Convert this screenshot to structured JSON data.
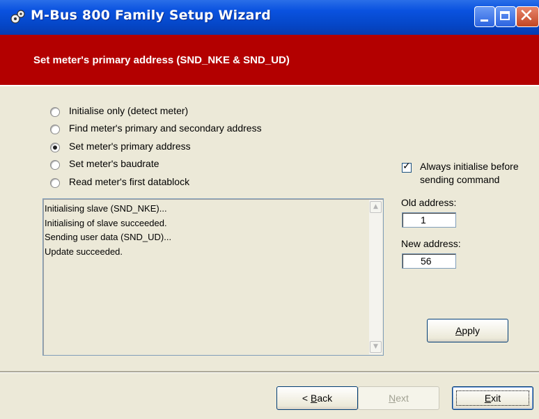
{
  "window": {
    "title": "M-Bus 800 Family Setup Wizard",
    "icon": "wizard-app-icon",
    "controls": [
      "minimize",
      "maximize",
      "close"
    ]
  },
  "header": {
    "title": "Set meter's primary address (SND_NKE & SND_UD)",
    "background_color": "#b30000"
  },
  "options": [
    {
      "label": "Initialise only (detect meter)",
      "checked": false
    },
    {
      "label": "Find meter's primary and secondary address",
      "checked": false
    },
    {
      "label": "Set meter's primary address",
      "checked": true
    },
    {
      "label": "Set meter's baudrate",
      "checked": false
    },
    {
      "label": "Read meter's first datablock",
      "checked": false
    }
  ],
  "log": {
    "lines": [
      "Initialising slave (SND_NKE)...",
      "Initialising of slave succeeded.",
      "Sending user data (SND_UD)...",
      "Update succeeded."
    ]
  },
  "always_initialise": {
    "checked": true,
    "line1": "Always initialise before",
    "line2": "sending command"
  },
  "old_address": {
    "label": "Old address:",
    "value": "1"
  },
  "new_address": {
    "label": "New address:",
    "value": "56"
  },
  "buttons": {
    "apply_pre": "",
    "apply_mnemonic": "A",
    "apply_post": "pply",
    "back_pre": "< ",
    "back_mnemonic": "B",
    "back_post": "ack",
    "next_pre": "",
    "next_mnemonic": "N",
    "next_post": "ext",
    "exit_pre": "",
    "exit_mnemonic": "E",
    "exit_post": "xit"
  }
}
